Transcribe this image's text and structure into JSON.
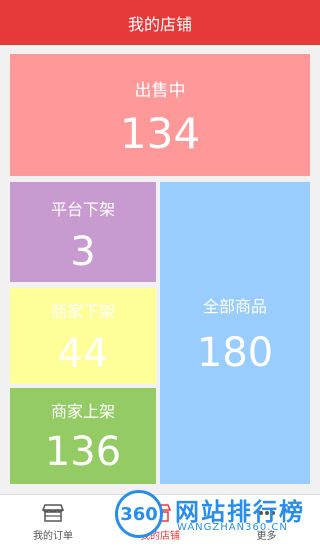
{
  "header": {
    "title": "我的店铺"
  },
  "tiles": {
    "selling": {
      "label": "出售中",
      "count": "134"
    },
    "platform_off": {
      "label": "平台下架",
      "count": "3"
    },
    "merchant_off": {
      "label": "商家下架",
      "count": "44"
    },
    "merchant_on": {
      "label": "商家上架",
      "count": "136"
    },
    "all": {
      "label": "全部商品",
      "count": "180"
    }
  },
  "tabbar": {
    "orders": {
      "label": "我的订单",
      "icon": "store-icon"
    },
    "store": {
      "label": "我的店铺",
      "icon": "shop-icon"
    },
    "more": {
      "label": "更多",
      "icon": "more-icon"
    }
  },
  "watermark": {
    "logo": "360",
    "title": "网站排行榜",
    "url": "WANGZHAN360.CN"
  },
  "colors": {
    "header": "#e63a3a",
    "selling": "#ff9999",
    "platform_off": "#c79bcf",
    "merchant_off": "#ffff99",
    "merchant_on": "#94cb64",
    "all": "#99ccff"
  }
}
